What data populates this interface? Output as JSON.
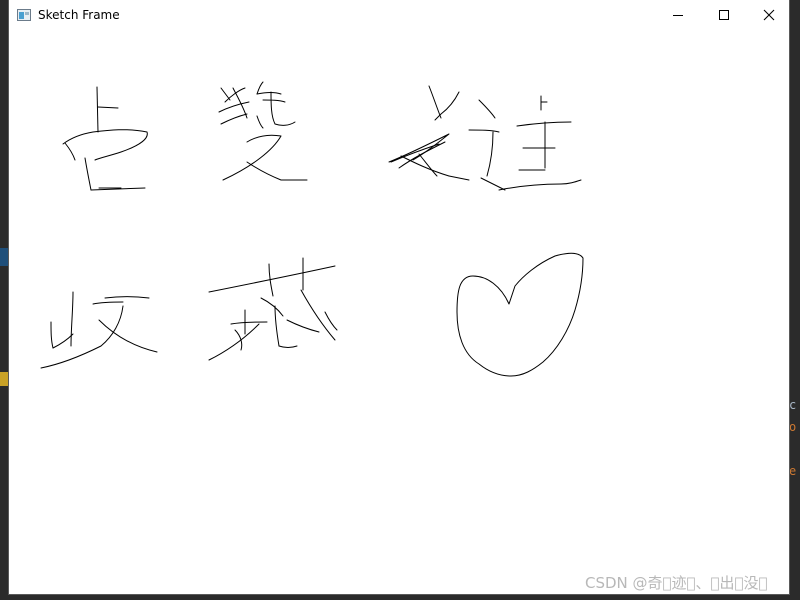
{
  "window": {
    "title": "Sketch Frame",
    "controls": {
      "minimize_icon": "minimize-icon",
      "maximize_icon": "maximize-icon",
      "close_icon": "close-icon"
    }
  },
  "canvas": {
    "background_color": "#ffffff",
    "stroke_color": "#000000",
    "sketches": [
      "hand-drawn-glyph-1",
      "hand-drawn-glyph-2",
      "hand-drawn-glyph-3",
      "hand-drawn-glyph-4",
      "hand-drawn-glyph-5",
      "hand-drawn-heart"
    ]
  },
  "background_editor": {
    "right_edge_text": [
      "c",
      "o",
      "e"
    ]
  },
  "watermark": "CSDN @奇\u0000迹\u0000、\u0000出\u0000没\u0000"
}
